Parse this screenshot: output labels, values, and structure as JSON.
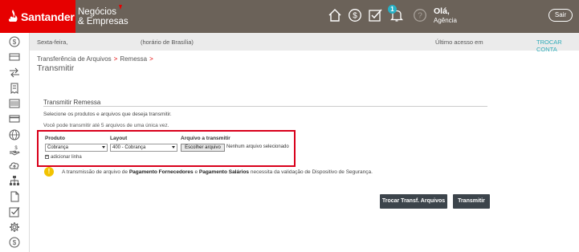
{
  "brand": {
    "name": "Santander",
    "sub_line1": "Negócios",
    "sub_line2": "& Empresas"
  },
  "header": {
    "icons": [
      "home-icon",
      "money-icon",
      "checklist-icon",
      "bell-icon",
      "help-icon"
    ],
    "notification_count": "1",
    "greeting": "Olá,",
    "greeting_sub": "Agência",
    "exit_label": "Sair",
    "colors": {
      "bar": "#6b6259",
      "brand": "#e60000",
      "badge": "#27b0c5"
    }
  },
  "infobar": {
    "day": "Sexta-feira,",
    "time_zone": "(horário de Brasília)",
    "last_access": "Último acesso em",
    "switch_account": "TROCAR CONTA"
  },
  "breadcrumb": {
    "item1": "Transferência de Arquivos",
    "sep": ">",
    "item2": "Remessa"
  },
  "page_title": "Transmitir",
  "form": {
    "section_title": "Transmitir Remessa",
    "instruction": "Selecione os produtos e arquivos que deseja transmitir.",
    "limit_note": "Você pode transmitir até 5 arquivos de uma única vez.",
    "col_product": "Produto",
    "col_layout": "Layout",
    "col_file": "Arquivo a transmitir",
    "product_value": "Cobrança",
    "layout_value": "400  - Cobrança",
    "file_button": "Escolher arquivo",
    "file_status": "Nenhum arquivo selecionado",
    "add_line": "adicionar linha"
  },
  "warning": {
    "icon": "!",
    "text_before": "A transmissão de arquivo de ",
    "bold1": "Pagamento Fornecedores",
    "text_mid": " e ",
    "bold2": "Pagamento Salários",
    "text_after": " necessita da validação de Dispositivo de Segurança."
  },
  "actions": {
    "switch_transfer": "Trocar Transf. Arquivos",
    "transmit": "Transmitir"
  },
  "sidebar_icons": [
    "money-icon",
    "card-icon",
    "transfer-icon",
    "receipt-icon",
    "barcode-icon",
    "card-icon",
    "globe-icon",
    "hand-money-icon",
    "cloud-upload-icon",
    "org-chart-icon",
    "document-icon",
    "checklist-icon",
    "gear-icon",
    "money-icon"
  ]
}
